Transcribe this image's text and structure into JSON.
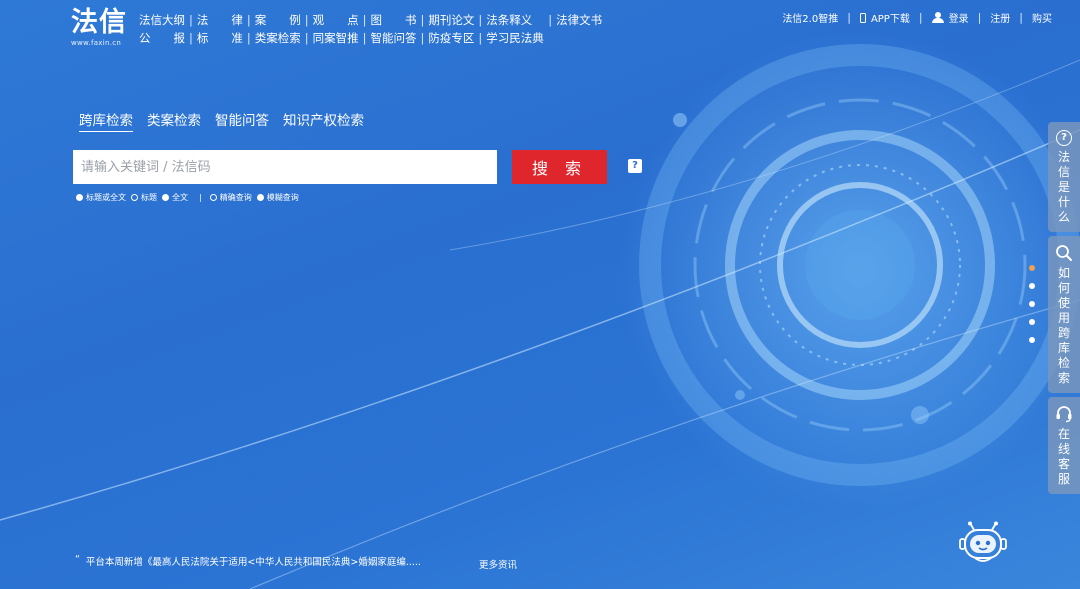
{
  "logo": {
    "main": "法信",
    "sub": "www.faxin.cn"
  },
  "topnav": {
    "row1": [
      "法信大纲",
      "法律",
      "案例",
      "观点",
      "图书",
      "期刊论文",
      "法条释义",
      "法律文书"
    ],
    "row2": [
      "公报",
      "标准",
      "类案检索",
      "同案智推",
      "智能问答",
      "防疫专区",
      "学习民法典"
    ]
  },
  "rightnav": {
    "version": "法信2.0智推",
    "app": "APP下载",
    "login": "登录",
    "register": "注册",
    "buy": "购买"
  },
  "search": {
    "tabs": [
      "跨库检索",
      "类案检索",
      "智能问答",
      "知识产权检索"
    ],
    "active_tab": 0,
    "placeholder": "请输入关键词 / 法信码",
    "button": "搜 索",
    "help": "?",
    "scope_options": [
      "标题或全文",
      "标题",
      "全文"
    ],
    "mode_options": [
      "精确查询",
      "模糊查询"
    ]
  },
  "news": {
    "quote": "“",
    "text": "平台本周新增《最高人民法院关于适用<中华人民共和国民法典>婚姻家庭编.....",
    "more": "更多资讯"
  },
  "sidepanel": {
    "items": [
      {
        "icon": "question-icon",
        "label": "法信是什么"
      },
      {
        "icon": "search-icon",
        "label": "如何使用跨库检索"
      },
      {
        "icon": "headset-icon",
        "label": "在线客服"
      }
    ]
  },
  "carousel": {
    "dot_count": 5,
    "active": 0
  },
  "colors": {
    "background": "#2b74d4",
    "search_button": "#e0262d",
    "active_dot": "#f0a050"
  }
}
